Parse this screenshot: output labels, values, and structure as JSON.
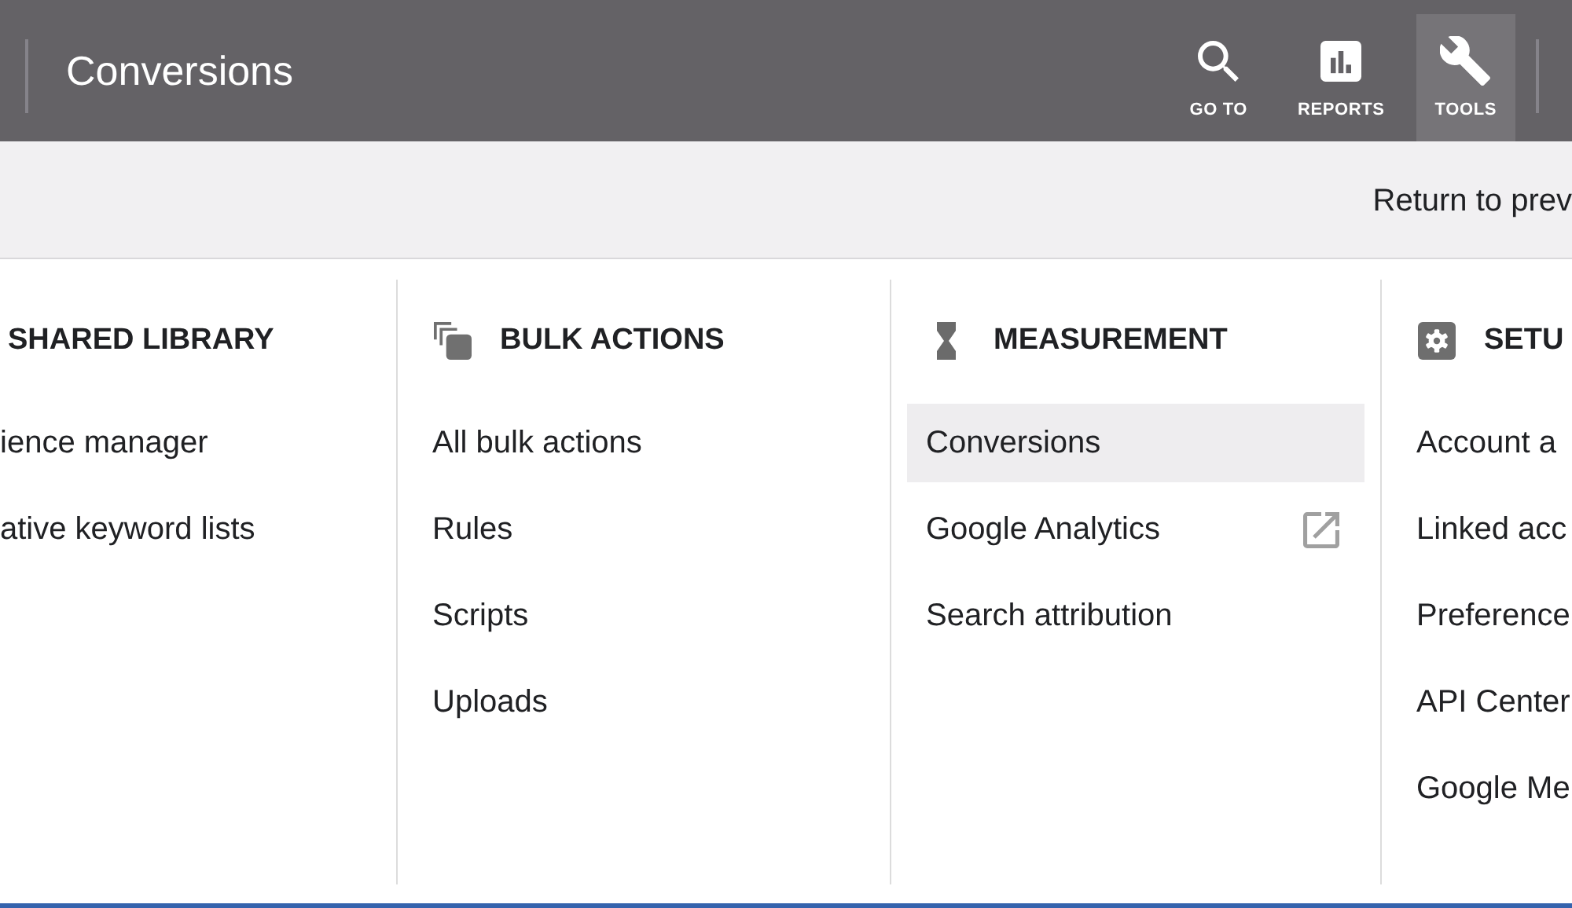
{
  "header": {
    "title": "Conversions",
    "nav": [
      {
        "label": "GO TO",
        "kind": "search",
        "selected": false
      },
      {
        "label": "REPORTS",
        "kind": "reports",
        "selected": false
      },
      {
        "label": "TOOLS",
        "kind": "tools",
        "selected": true
      }
    ]
  },
  "subbar": {
    "link": "Return to prev"
  },
  "menu": {
    "columns": [
      {
        "heading": "SHARED LIBRARY",
        "kind": "library",
        "items": [
          {
            "label": "ience manager",
            "selected": false,
            "external": false
          },
          {
            "label": "ative keyword lists",
            "selected": false,
            "external": false
          }
        ]
      },
      {
        "heading": "BULK ACTIONS",
        "kind": "bulk",
        "items": [
          {
            "label": "All bulk actions",
            "selected": false,
            "external": false
          },
          {
            "label": "Rules",
            "selected": false,
            "external": false
          },
          {
            "label": "Scripts",
            "selected": false,
            "external": false
          },
          {
            "label": "Uploads",
            "selected": false,
            "external": false
          }
        ]
      },
      {
        "heading": "MEASUREMENT",
        "kind": "measurement",
        "items": [
          {
            "label": "Conversions",
            "selected": true,
            "external": false
          },
          {
            "label": "Google Analytics",
            "selected": false,
            "external": true
          },
          {
            "label": "Search attribution",
            "selected": false,
            "external": false
          }
        ]
      },
      {
        "heading": "SETU",
        "kind": "setup",
        "items": [
          {
            "label": "Account a",
            "selected": false,
            "external": false
          },
          {
            "label": "Linked acc",
            "selected": false,
            "external": false
          },
          {
            "label": "Preference",
            "selected": false,
            "external": false
          },
          {
            "label": "API Center",
            "selected": false,
            "external": false
          },
          {
            "label": "Google Me",
            "selected": false,
            "external": false
          }
        ]
      }
    ]
  }
}
